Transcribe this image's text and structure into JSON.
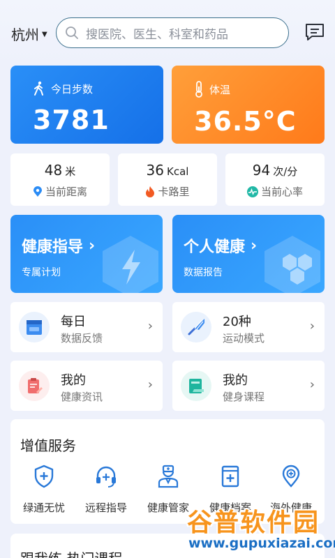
{
  "header": {
    "city": "杭州",
    "search_placeholder": "搜医院、医生、科室和药品"
  },
  "cards": {
    "steps": {
      "label": "今日步数",
      "value": "3781"
    },
    "temp": {
      "label": "体温",
      "value": "36.5°C"
    }
  },
  "stats": [
    {
      "value": "48",
      "unit": "米",
      "label": "当前距离"
    },
    {
      "value": "36",
      "unit": "Kcal",
      "label": "卡路里"
    },
    {
      "value": "94",
      "unit": "次/分",
      "label": "当前心率"
    }
  ],
  "banners": [
    {
      "title": "健康指导",
      "sub": "专属计划"
    },
    {
      "title": "个人健康",
      "sub": "数据报告"
    }
  ],
  "tiles": [
    {
      "title": "每日",
      "sub": "数据反馈"
    },
    {
      "title": "20种",
      "sub": "运动模式"
    },
    {
      "title": "我的",
      "sub": "健康资讯"
    },
    {
      "title": "我的",
      "sub": "健身课程"
    }
  ],
  "services": {
    "title": "增值服务",
    "items": [
      {
        "label": "绿通无忧",
        "icon": "shield-plus-icon"
      },
      {
        "label": "远程指导",
        "icon": "headset-icon"
      },
      {
        "label": "健康管家",
        "icon": "doctor-icon"
      },
      {
        "label": "健康档案",
        "icon": "health-record-icon"
      },
      {
        "label": "海外健康",
        "icon": "location-plus-icon"
      }
    ]
  },
  "next_section": {
    "title": "跟我练 热门课程"
  },
  "watermark": {
    "cn": "谷普软件园",
    "en": "www.gupuxiazai.com"
  },
  "colors": {
    "primary": "#1f86f5",
    "orange": "#ff8a24",
    "bg": "#eef1fb"
  }
}
